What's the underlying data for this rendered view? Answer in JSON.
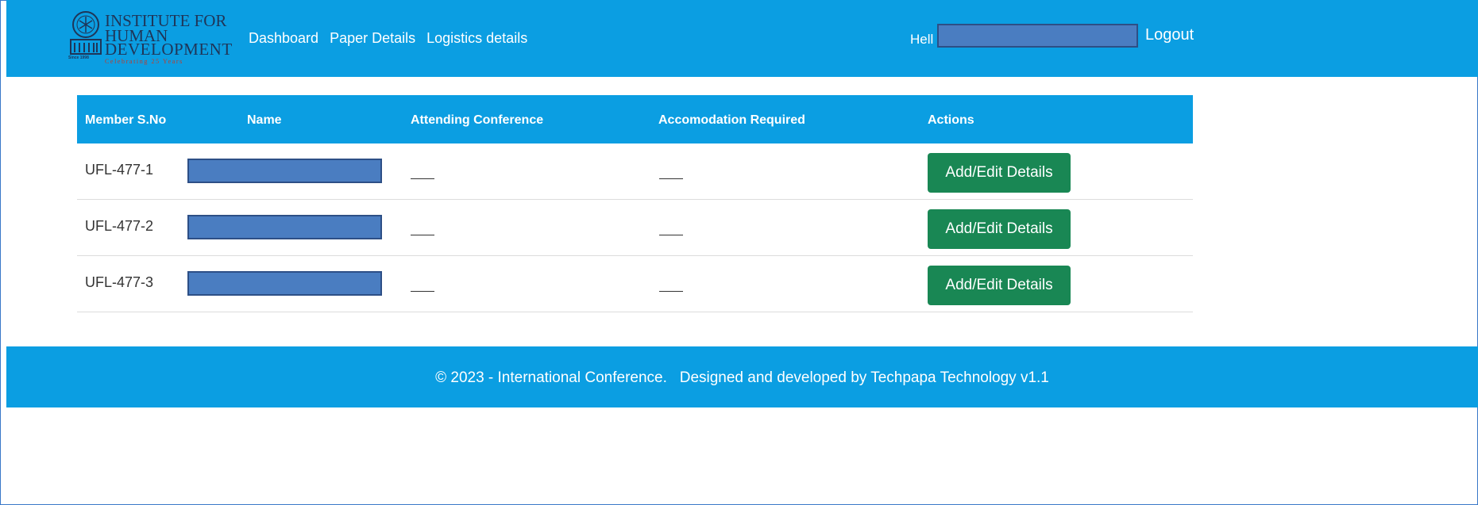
{
  "brand": {
    "line1": "INSTITUTE FOR",
    "line2": "HUMAN",
    "line3": "DEVELOPMENT",
    "since": "Since 1998",
    "tagline": "Celebrating 25 Years"
  },
  "nav": {
    "items": [
      "Dashboard",
      "Paper Details",
      "Logistics details"
    ]
  },
  "user": {
    "greeting": "Hell",
    "logout_label": "Logout"
  },
  "table": {
    "columns": [
      "Member S.No",
      "Name",
      "Attending Conference",
      "Accomodation Required",
      "Actions"
    ],
    "rows": [
      {
        "sno": "UFL-477-1",
        "action_label": "Add/Edit Details"
      },
      {
        "sno": "UFL-477-2",
        "action_label": "Add/Edit Details"
      },
      {
        "sno": "UFL-477-3",
        "action_label": "Add/Edit Details"
      }
    ]
  },
  "footer": {
    "text": "© 2023 - International Conference.   Designed and developed by Techpapa Technology v1.1"
  },
  "colors": {
    "header_bg": "#0b9ee2",
    "button_bg": "#198754",
    "redaction": "#4a7dc1"
  }
}
